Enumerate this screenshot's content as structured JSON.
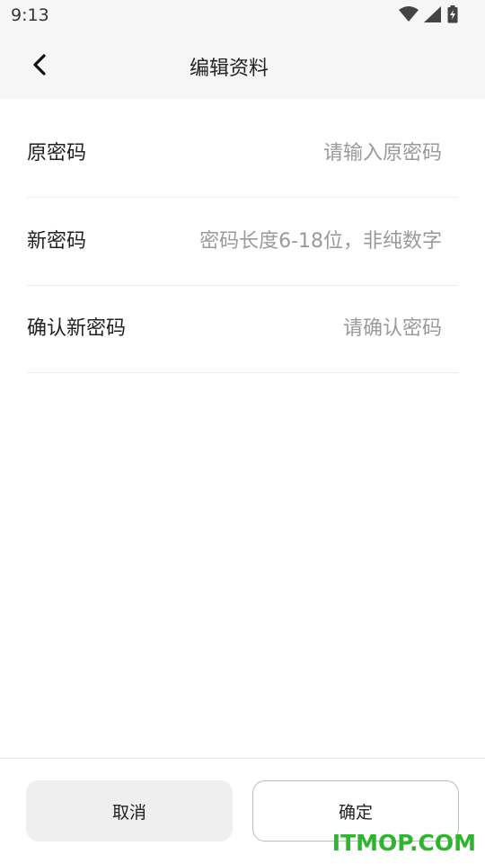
{
  "status_bar": {
    "time": "9:13",
    "icons": [
      "wifi-icon",
      "cellular-signal-icon",
      "battery-charging-icon"
    ]
  },
  "header": {
    "back_icon": "chevron-left-icon",
    "title": "编辑资料"
  },
  "form": {
    "old_password": {
      "label": "原密码",
      "placeholder": "请输入原密码",
      "value": ""
    },
    "new_password": {
      "label": "新密码",
      "placeholder": "密码长度6-18位，非纯数字",
      "value": ""
    },
    "confirm_password": {
      "label": "确认新密码",
      "placeholder": "请确认密码",
      "value": ""
    }
  },
  "actions": {
    "cancel_label": "取消",
    "confirm_label": "确定"
  },
  "watermark": "ITMOP.COM",
  "colors": {
    "header_bg": "#f6f6f6",
    "placeholder": "#9a9a9a",
    "cancel_bg": "#efefef",
    "watermark": "#2db52d"
  }
}
